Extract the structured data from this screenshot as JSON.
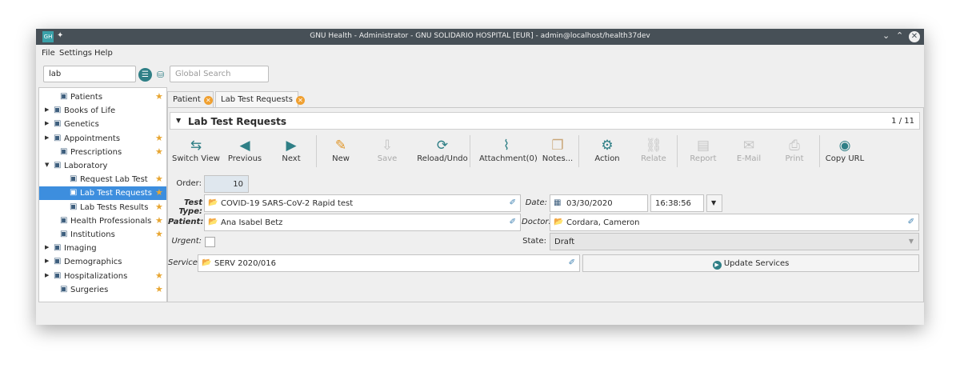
{
  "window": {
    "title": "GNU Health - Administrator - GNU SOLIDARIO HOSPITAL [EUR] - admin@localhost/health37dev"
  },
  "menu": [
    "File",
    "Settings",
    "Help"
  ],
  "search": {
    "value": "lab",
    "global_placeholder": "Global Search"
  },
  "sidebar": {
    "items": [
      {
        "label": "Patients",
        "icon": "patient-icon",
        "expander": "",
        "star": true
      },
      {
        "label": "Books of Life",
        "icon": "book-icon",
        "expander": "▶",
        "star": false
      },
      {
        "label": "Genetics",
        "icon": "dna-icon",
        "expander": "▶",
        "star": false
      },
      {
        "label": "Appointments",
        "icon": "calendar-icon",
        "expander": "▶",
        "star": true
      },
      {
        "label": "Prescriptions",
        "icon": "prescription-icon",
        "expander": "",
        "star": true
      },
      {
        "label": "Laboratory",
        "icon": "folder-icon",
        "expander": "▼",
        "star": false
      },
      {
        "label": "Request Lab Test",
        "icon": "gear-icon",
        "expander": "",
        "star": true
      },
      {
        "label": "Lab Test Requests",
        "icon": "document-icon",
        "expander": "",
        "star": true
      },
      {
        "label": "Lab Tests Results",
        "icon": "document-icon",
        "expander": "",
        "star": true
      },
      {
        "label": "Health Professionals",
        "icon": "doctor-icon",
        "expander": "",
        "star": true
      },
      {
        "label": "Institutions",
        "icon": "building-icon",
        "expander": "",
        "star": true
      },
      {
        "label": "Imaging",
        "icon": "image-icon",
        "expander": "▶",
        "star": false
      },
      {
        "label": "Demographics",
        "icon": "globe-icon",
        "expander": "▶",
        "star": false
      },
      {
        "label": "Hospitalizations",
        "icon": "bed-icon",
        "expander": "▶",
        "star": true
      },
      {
        "label": "Surgeries",
        "icon": "scalpel-icon",
        "expander": "",
        "star": true
      }
    ]
  },
  "tabs": [
    {
      "label": "Patient"
    },
    {
      "label": "Lab Test Requests"
    }
  ],
  "form": {
    "title": "Lab Test Requests",
    "record_count": "1 / 11",
    "toolbar": [
      {
        "label": "Switch View",
        "icon": "switch-view-icon",
        "glyph": "⇆",
        "disabled": false
      },
      {
        "label": "Previous",
        "icon": "previous-icon",
        "glyph": "◀",
        "disabled": false
      },
      {
        "label": "Next",
        "icon": "next-icon",
        "glyph": "▶",
        "disabled": false
      },
      {
        "label": "New",
        "icon": "new-icon",
        "glyph": "✎",
        "disabled": false
      },
      {
        "label": "Save",
        "icon": "save-icon",
        "glyph": "⇩",
        "disabled": true
      },
      {
        "label": "Reload/Undo",
        "icon": "reload-icon",
        "glyph": "⟳",
        "disabled": false
      },
      {
        "label": "Attachment(0)",
        "icon": "attachment-icon",
        "glyph": "⌇",
        "disabled": false
      },
      {
        "label": "Notes...",
        "icon": "notes-icon",
        "glyph": "❐",
        "disabled": false
      },
      {
        "label": "Action",
        "icon": "action-icon",
        "glyph": "⚙",
        "disabled": false
      },
      {
        "label": "Relate",
        "icon": "relate-icon",
        "glyph": "⛓",
        "disabled": true
      },
      {
        "label": "Report",
        "icon": "report-icon",
        "glyph": "▤",
        "disabled": true
      },
      {
        "label": "E-Mail",
        "icon": "email-icon",
        "glyph": "✉",
        "disabled": true
      },
      {
        "label": "Print",
        "icon": "print-icon",
        "glyph": "⎙",
        "disabled": true
      },
      {
        "label": "Copy URL",
        "icon": "globe-icon",
        "glyph": "◉",
        "disabled": false
      }
    ],
    "order_label": "Order:",
    "order_value": "10",
    "test_type_label": "Test Type:",
    "test_type_value": "COVID-19 SARS-CoV-2 Rapid test",
    "date_label": "Date:",
    "date_value": "03/30/2020",
    "time_value": "16:38:56",
    "patient_label": "Patient:",
    "patient_value": "Ana Isabel Betz",
    "doctor_label": "Doctor:",
    "doctor_value": "Cordara, Cameron",
    "urgent_label": "Urgent:",
    "state_label": "State:",
    "state_value": "Draft",
    "service_label": "Service:",
    "service_value": "SERV 2020/016",
    "update_services_label": "Update Services"
  }
}
